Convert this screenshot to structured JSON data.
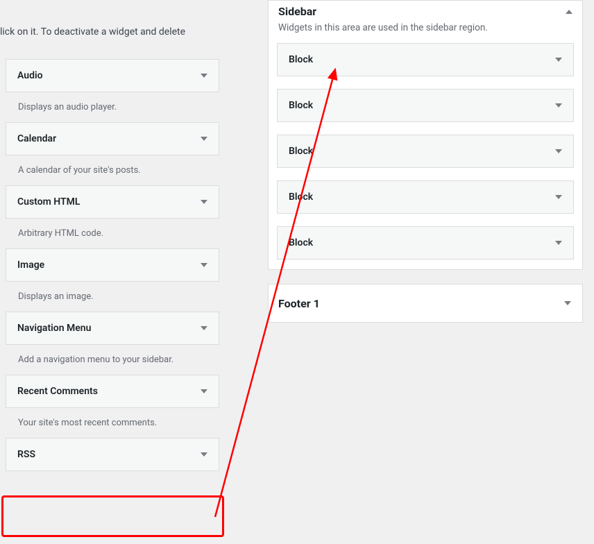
{
  "intro": "lick on it. To deactivate a widget and delete",
  "available_widgets": [
    {
      "title": "Audio",
      "desc": "Displays an audio player."
    },
    {
      "title": "Calendar",
      "desc": "A calendar of your site's posts."
    },
    {
      "title": "Custom HTML",
      "desc": "Arbitrary HTML code."
    },
    {
      "title": "Image",
      "desc": "Displays an image."
    },
    {
      "title": "Navigation Menu",
      "desc": "Add a navigation menu to your sidebar."
    },
    {
      "title": "Recent Comments",
      "desc": "Your site's most recent comments."
    },
    {
      "title": "RSS",
      "desc": ""
    }
  ],
  "sidebar_area": {
    "title": "Sidebar",
    "desc": "Widgets in this area are used in the sidebar region.",
    "widgets": [
      "Block",
      "Block",
      "Block",
      "Block",
      "Block"
    ]
  },
  "footer_area": {
    "title": "Footer 1"
  }
}
